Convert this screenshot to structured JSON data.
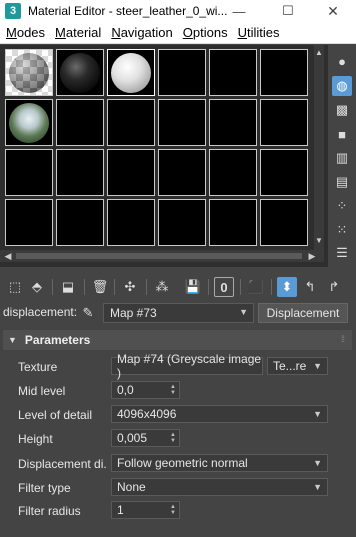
{
  "window": {
    "app_icon": "3",
    "title": "Material Editor - steer_leather_0_wi...",
    "min_symbol": "—",
    "max_symbol": "☐",
    "close_symbol": "✕"
  },
  "menu": [
    "Modes",
    "Material",
    "Navigation",
    "Options",
    "Utilities"
  ],
  "slots": {
    "vscroll_up": "▲",
    "vscroll_down": "▼",
    "hscroll_left": "◀",
    "hscroll_right": "▶"
  },
  "right_toolbar": {
    "icons": [
      "sphere-icon",
      "cylinder-icon",
      "checker-bg-icon",
      "box-icon",
      "color-bars-icon",
      "video-check-icon",
      "checker-pattern-icon",
      "material-select-icon",
      "options-list-icon"
    ]
  },
  "toolbar": {
    "icons": [
      "get-material-icon",
      "put-to-scene-icon",
      "assign-to-selection-icon",
      "delete-icon",
      "make-unique-icon",
      "put-to-library-icon",
      "material-id-icon",
      "show-in-viewport-icon",
      "show-end-result-icon",
      "go-to-parent-icon",
      "go-forward-icon"
    ],
    "material_id_label": "0"
  },
  "displacement": {
    "label": "displacement:",
    "map_name": "Map #73",
    "type_button": "Displacement"
  },
  "parameters": {
    "title": "Parameters",
    "rows": [
      {
        "label": "Texture",
        "value": "Map #74  (Greyscale image )",
        "extra": "Te...re"
      },
      {
        "label": "Mid level",
        "value": "0,0"
      },
      {
        "label": "Level of detail",
        "value": "4096x4096"
      },
      {
        "label": "Height",
        "value": "0,005"
      },
      {
        "label": "Displacement di...",
        "value": "Follow geometric normal"
      },
      {
        "label": "Filter type",
        "value": "None"
      },
      {
        "label": "Filter radius",
        "value": "1"
      }
    ]
  },
  "colors": {
    "accent": "#5b9bd5",
    "panel": "#444444",
    "slot_bg": "#000000"
  }
}
